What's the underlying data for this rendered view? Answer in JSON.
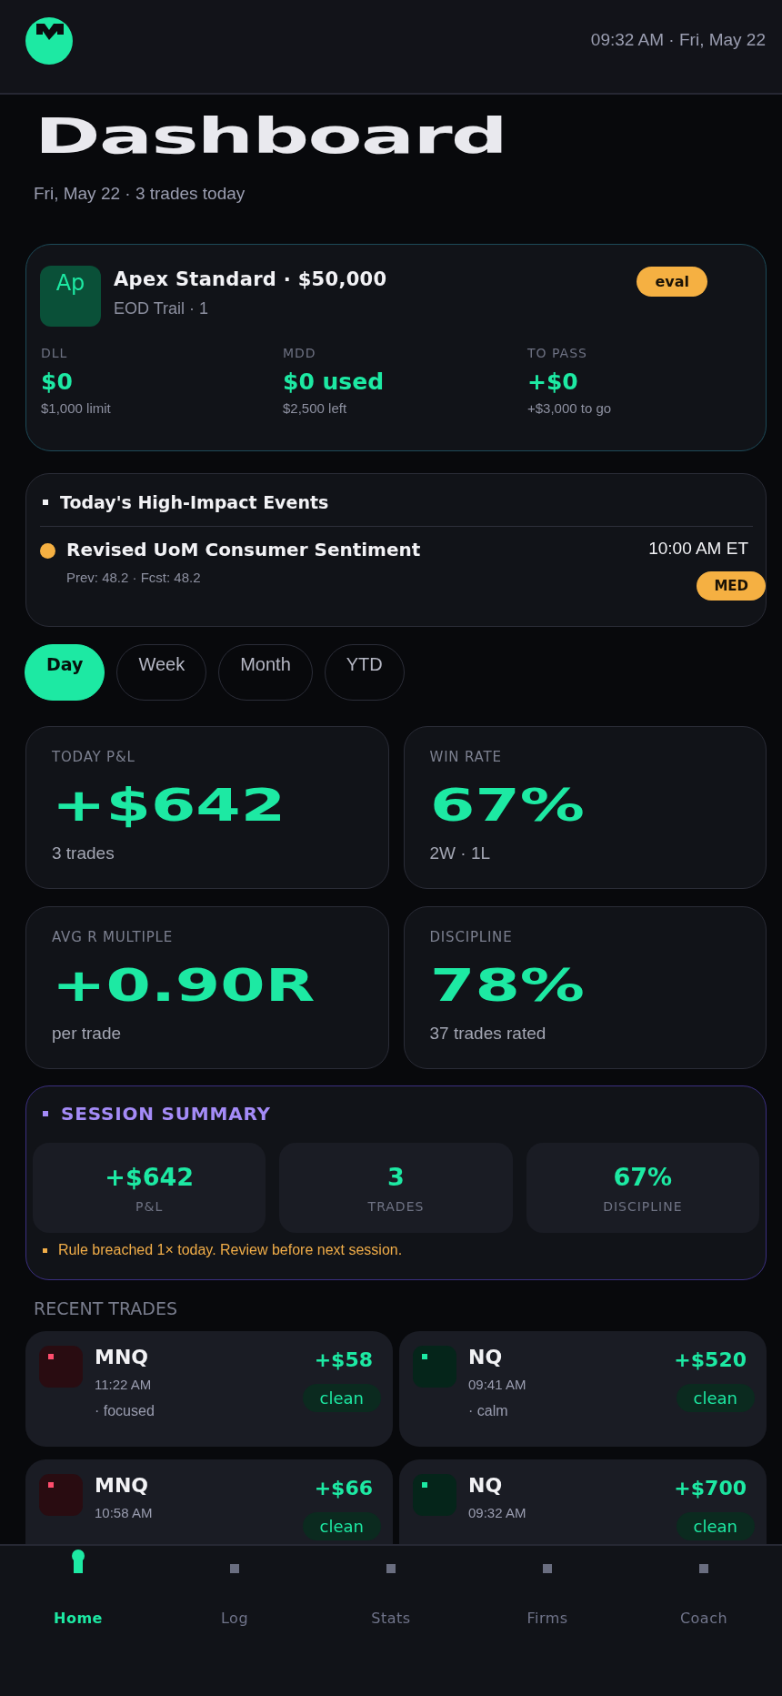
{
  "header": {
    "clock": "09:32 AM · Fri, May 22"
  },
  "page": {
    "title": "Dashboard",
    "subtitle": "Fri, May 22 · 3 trades today"
  },
  "account": {
    "avatar": "Ap",
    "name": "Apex Standard · $50,000",
    "detail": "EOD Trail · 1",
    "status": "eval",
    "metrics": [
      {
        "label": "DLL",
        "value": "$0",
        "note": "$1,000 limit"
      },
      {
        "label": "MDD",
        "value": "$0 used",
        "note": "$2,500 left"
      },
      {
        "label": "TO PASS",
        "value": "+$0",
        "note": "+$3,000 to go"
      }
    ]
  },
  "events": {
    "title": "Today's High-Impact Events",
    "items": [
      {
        "name": "Revised UoM Consumer Sentiment",
        "detail": "Prev: 48.2 · Fcst: 48.2",
        "time": "10:00 AM ET",
        "impact": "MED",
        "color": "#f5b042"
      }
    ]
  },
  "periods": [
    {
      "label": "Day",
      "selected": true
    },
    {
      "label": "Week",
      "selected": false
    },
    {
      "label": "Month",
      "selected": false
    },
    {
      "label": "YTD",
      "selected": false
    }
  ],
  "stats": [
    {
      "label": "TODAY P&L",
      "value": "+$642",
      "note": "3 trades"
    },
    {
      "label": "WIN RATE",
      "value": "67%",
      "note": "2W · 1L"
    },
    {
      "label": "AVG R MULTIPLE",
      "value": "+0.90R",
      "note": "per trade"
    },
    {
      "label": "DISCIPLINE",
      "value": "78%",
      "note": "37 trades rated"
    }
  ],
  "session_summary": {
    "title": "SESSION SUMMARY",
    "metrics": [
      {
        "value": "+$642",
        "label": "P&L"
      },
      {
        "value": "3",
        "label": "TRADES"
      },
      {
        "value": "67%",
        "label": "DISCIPLINE"
      }
    ],
    "note": "Rule breached 1× today. Review before next session."
  },
  "recent_trades": {
    "title": "RECENT TRADES",
    "items": [
      {
        "symbol": "MNQ",
        "time": "11:22 AM",
        "mood": "· focused",
        "pnl": "+$58",
        "tag": "clean",
        "color": "#ff4d6d"
      },
      {
        "symbol": "NQ",
        "time": "09:41 AM",
        "mood": "· calm",
        "pnl": "+$520",
        "tag": "clean",
        "color": "#1de9a3"
      },
      {
        "symbol": "MNQ",
        "time": "10:58 AM",
        "pnl": "+$66",
        "tag": "clean",
        "color": "#ff4d6d"
      },
      {
        "symbol": "NQ",
        "time": "09:32 AM",
        "pnl": "+$700",
        "tag": "clean",
        "color": "#1de9a3"
      }
    ]
  },
  "nav": [
    {
      "label": "Home",
      "selected": true
    },
    {
      "label": "Log",
      "selected": false
    },
    {
      "label": "Stats",
      "selected": false
    },
    {
      "label": "Firms",
      "selected": false
    },
    {
      "label": "Coach",
      "selected": false
    }
  ]
}
